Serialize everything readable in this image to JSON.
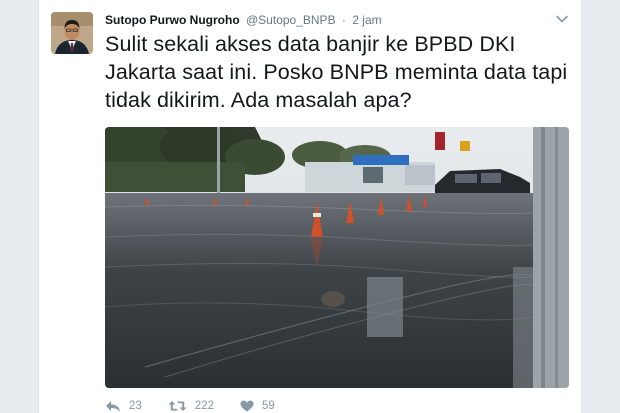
{
  "tweet": {
    "author_name": "Sutopo Purwo Nugroho",
    "handle": "@Sutopo_BNPB",
    "separator": "·",
    "time": "2 jam",
    "text": "Sulit sekali akses data banjir ke BPBD DKI Jakarta saat ini. Posko BNPB meminta data tapi tidak dikirim. Ada masalah apa?",
    "media_icon": "flood-photo"
  },
  "actions": {
    "reply_count": "23",
    "retweet_count": "222",
    "like_count": "59"
  },
  "colors": {
    "background": "#e6ecf0",
    "text": "#14171a",
    "secondary": "#657786",
    "action": "#8899a6"
  }
}
